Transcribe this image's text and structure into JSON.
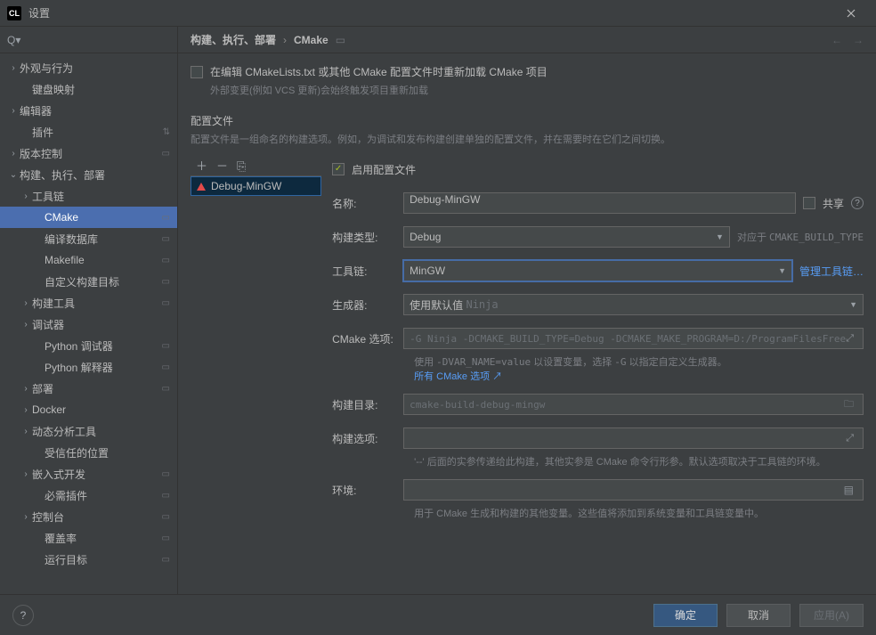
{
  "window": {
    "title": "设置"
  },
  "search": {
    "placeholder": "Q▾"
  },
  "tree": {
    "items": [
      {
        "label": "外观与行为",
        "chev": "›",
        "indent": 0
      },
      {
        "label": "键盘映射",
        "chev": "",
        "indent": 1
      },
      {
        "label": "编辑器",
        "chev": "›",
        "indent": 0
      },
      {
        "label": "插件",
        "chev": "",
        "indent": 1,
        "badge": "⇅"
      },
      {
        "label": "版本控制",
        "chev": "›",
        "indent": 0,
        "badge": "▭"
      },
      {
        "label": "构建、执行、部署",
        "chev": "⌄",
        "indent": 0
      },
      {
        "label": "工具链",
        "chev": "›",
        "indent": 1
      },
      {
        "label": "CMake",
        "chev": "",
        "indent": 2,
        "selected": true,
        "badge": "▭"
      },
      {
        "label": "编译数据库",
        "chev": "",
        "indent": 2,
        "badge": "▭"
      },
      {
        "label": "Makefile",
        "chev": "",
        "indent": 2,
        "badge": "▭"
      },
      {
        "label": "自定义构建目标",
        "chev": "",
        "indent": 2,
        "badge": "▭"
      },
      {
        "label": "构建工具",
        "chev": "›",
        "indent": 1,
        "badge": "▭"
      },
      {
        "label": "调试器",
        "chev": "›",
        "indent": 1
      },
      {
        "label": "Python 调试器",
        "chev": "",
        "indent": 2,
        "badge": "▭"
      },
      {
        "label": "Python 解释器",
        "chev": "",
        "indent": 2,
        "badge": "▭"
      },
      {
        "label": "部署",
        "chev": "›",
        "indent": 1,
        "badge": "▭"
      },
      {
        "label": "Docker",
        "chev": "›",
        "indent": 1
      },
      {
        "label": "动态分析工具",
        "chev": "›",
        "indent": 1
      },
      {
        "label": "受信任的位置",
        "chev": "",
        "indent": 2
      },
      {
        "label": "嵌入式开发",
        "chev": "›",
        "indent": 1,
        "badge": "▭"
      },
      {
        "label": "必需插件",
        "chev": "",
        "indent": 2,
        "badge": "▭"
      },
      {
        "label": "控制台",
        "chev": "›",
        "indent": 1,
        "badge": "▭"
      },
      {
        "label": "覆盖率",
        "chev": "",
        "indent": 2,
        "badge": "▭"
      },
      {
        "label": "运行目标",
        "chev": "",
        "indent": 2,
        "badge": "▭"
      }
    ]
  },
  "breadcrumb": {
    "a": "构建、执行、部署",
    "b": "CMake"
  },
  "reload": {
    "label": "在编辑 CMakeLists.txt 或其他 CMake 配置文件时重新加载 CMake 项目",
    "hint": "外部变更(例如 VCS 更新)会始终触发项目重新加载"
  },
  "profiles_section": {
    "title": "配置文件",
    "desc": "配置文件是一组命名的构建选项。例如，为调试和发布构建创建单独的配置文件，并在需要时在它们之间切换。"
  },
  "profile_list": {
    "item0": "Debug-MinGW"
  },
  "form": {
    "enable_label": "启用配置文件",
    "name_label": "名称:",
    "name_value": "Debug-MinGW",
    "share_label": "共享",
    "buildtype_label": "构建类型:",
    "buildtype_value": "Debug",
    "buildtype_hint_pre": "对应于 ",
    "buildtype_hint_code": "CMAKE_BUILD_TYPE",
    "toolchain_label": "工具链:",
    "toolchain_value": "MinGW",
    "toolchain_manage": "管理工具链…",
    "generator_label": "生成器:",
    "generator_prefix": "使用默认值",
    "generator_value": "Ninja",
    "cmakeopts_label": "CMake 选项:",
    "cmakeopts_value": "-G Ninja -DCMAKE_BUILD_TYPE=Debug -DCMAKE_MAKE_PROGRAM=D:/ProgramFilesFree",
    "cmakeopts_hint_a": "使用 ",
    "cmakeopts_hint_code": "-DVAR_NAME=value",
    "cmakeopts_hint_b": " 以设置变量，选择 ",
    "cmakeopts_hint_code2": "-G",
    "cmakeopts_hint_c": " 以指定自定义生成器。",
    "cmakeopts_link": "所有 CMake 选项 ↗",
    "builddir_label": "构建目录:",
    "builddir_value": "cmake-build-debug-mingw",
    "buildopts_label": "构建选项:",
    "buildopts_hint": "'--' 后面的实参传递给此构建，其他实参是 CMake 命令行形参。默认选项取决于工具链的环境。",
    "env_label": "环境:",
    "env_hint": "用于 CMake 生成和构建的其他变量。这些值将添加到系统变量和工具链变量中。"
  },
  "footer": {
    "ok": "确定",
    "cancel": "取消",
    "apply": "应用(A)"
  }
}
